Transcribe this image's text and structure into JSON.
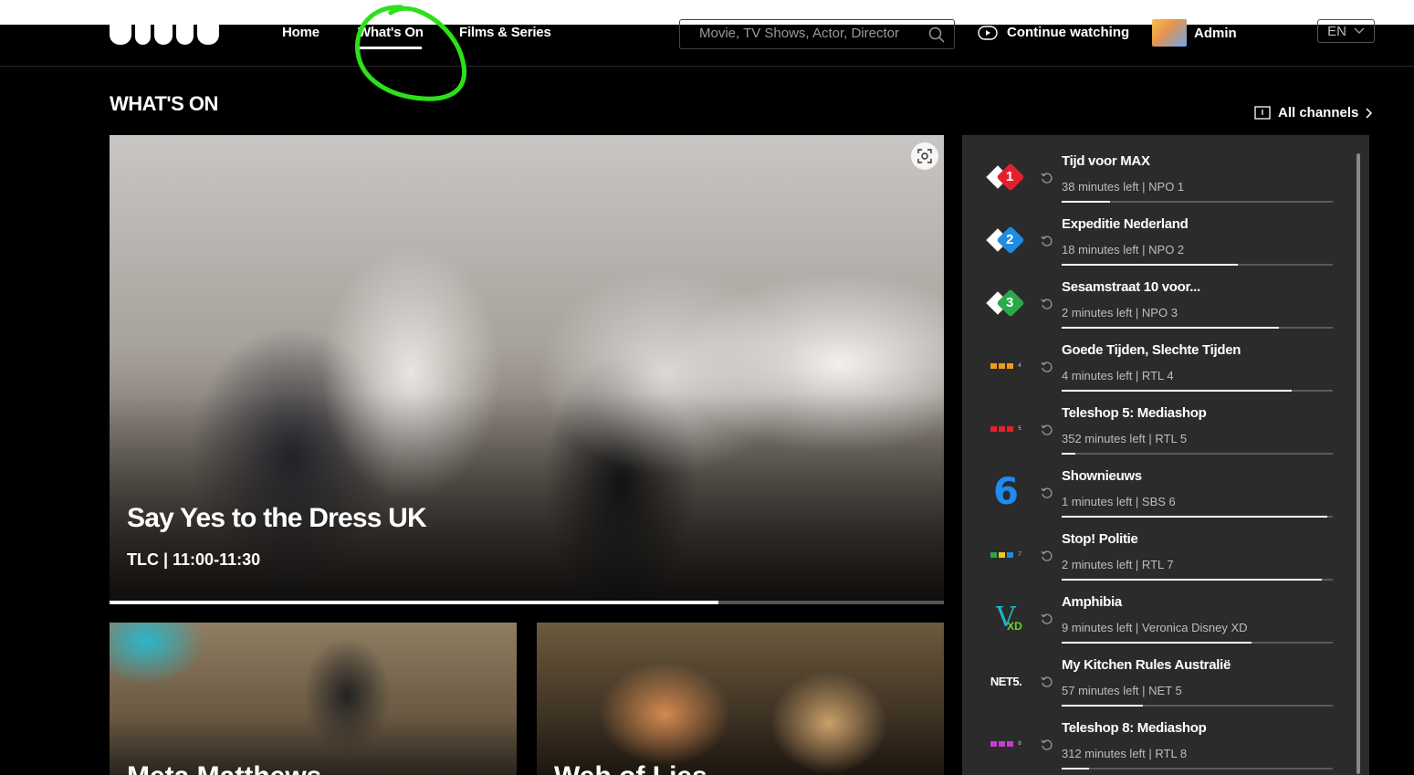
{
  "nav": {
    "links": [
      "Home",
      "What's On",
      "Films & Series"
    ],
    "search_placeholder": "Movie, TV Shows, Actor, Director",
    "continue_watching": "Continue watching",
    "user_name": "Admin",
    "language": "EN"
  },
  "page": {
    "title": "WHAT'S ON",
    "all_channels": "All channels"
  },
  "hero": {
    "title": "Say Yes to the Dress UK",
    "meta": "TLC | 11:00-11:30",
    "progress": 0.73
  },
  "cards": [
    {
      "title": "Meta Matthews"
    },
    {
      "title": "Web of Lies"
    }
  ],
  "channels": [
    {
      "title": "Tijd voor MAX",
      "meta": "38 minutes left | NPO 1",
      "logo": "npo1-logo",
      "progress": 0.18
    },
    {
      "title": "Expeditie Nederland",
      "meta": "18 minutes left | NPO 2",
      "logo": "npo2-logo",
      "progress": 0.65
    },
    {
      "title": "Sesamstraat 10 voor...",
      "meta": "2 minutes left | NPO 3",
      "logo": "npo3-logo",
      "progress": 0.8
    },
    {
      "title": "Goede Tijden, Slechte Tijden",
      "meta": "4 minutes left | RTL 4",
      "logo": "rtl4-logo",
      "progress": 0.85
    },
    {
      "title": "Teleshop 5: Mediashop",
      "meta": "352 minutes left | RTL 5",
      "logo": "rtl5-logo",
      "progress": 0.05
    },
    {
      "title": "Shownieuws",
      "meta": "1 minutes left | SBS 6",
      "logo": "sbs6-logo",
      "progress": 0.98
    },
    {
      "title": "Stop! Politie",
      "meta": "2 minutes left | RTL 7",
      "logo": "rtl7-logo",
      "progress": 0.96
    },
    {
      "title": "Amphibia",
      "meta": "9 minutes left | Veronica Disney XD",
      "logo": "veronica-disney-xd-logo",
      "progress": 0.7
    },
    {
      "title": "My Kitchen Rules Australië",
      "meta": "57 minutes left | NET 5",
      "logo": "net5-logo",
      "progress": 0.3
    },
    {
      "title": "Teleshop 8: Mediashop",
      "meta": "312 minutes left | RTL 8",
      "logo": "rtl8-logo",
      "progress": 0.1
    }
  ],
  "channel_logo_text": {
    "net5": "NET5."
  },
  "colors": {
    "npo_red": "#e4202d",
    "npo_blue": "#1e8ce0",
    "npo_green": "#2aa84a",
    "annotation": "#2de01a"
  }
}
